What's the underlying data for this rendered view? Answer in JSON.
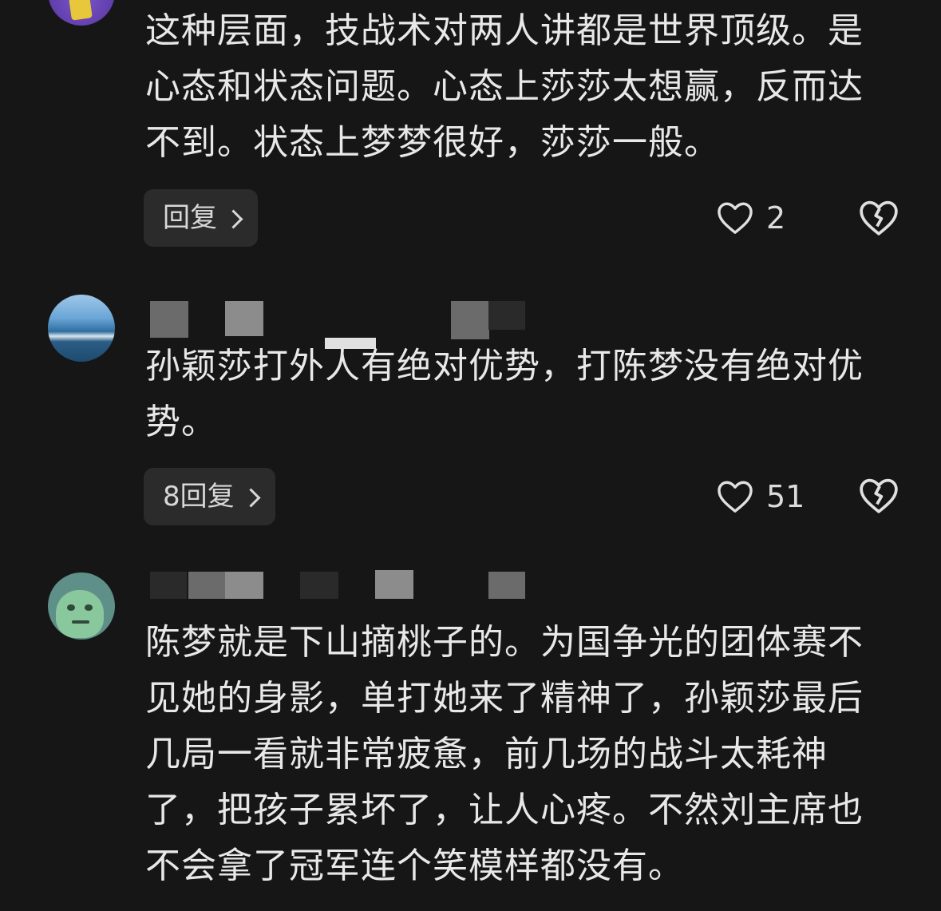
{
  "comments": [
    {
      "text": "这种层面，技战术对两人讲都是世界顶级。是心态和状态问题。心态上莎莎太想赢，反而达不到。状态上梦梦很好，莎莎一般。",
      "reply_label": "回复",
      "likes": "2"
    },
    {
      "text": "孙颖莎打外人有绝对优势，打陈梦没有绝对优势。",
      "reply_label": "8回复",
      "likes": "51"
    },
    {
      "text": "陈梦就是下山摘桃子的。为国争光的团体赛不见她的身影，单打她来了精神了，孙颖莎最后几局一看就非常疲惫，前几场的战斗太耗神了，把孩子累坏了，让人心疼。不然刘主席也不会拿了冠军连个笑模样都没有。"
    }
  ],
  "icons": {
    "like": "heart-outline-icon",
    "dislike": "broken-heart-icon",
    "reply_chevron": "chevron-right-icon"
  },
  "colors": {
    "background": "#161616",
    "text": "#e8e8e8",
    "button_bg": "#2b2b2b"
  }
}
